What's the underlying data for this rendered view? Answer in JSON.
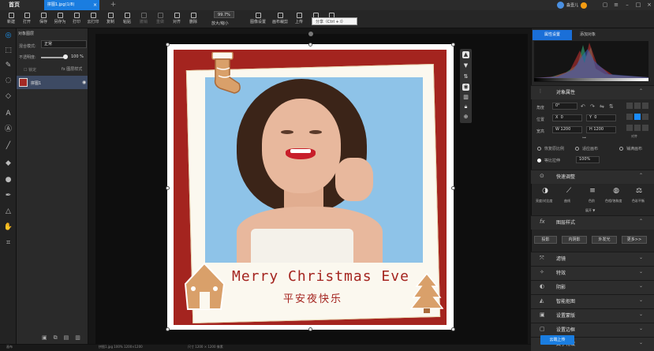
{
  "title_bar": {
    "home_label": "首页",
    "doc_tab_label": "拼图1.jpg(1/8)",
    "doc_tab_close": "×",
    "add_tab": "+",
    "user_name": "淼壹儿"
  },
  "toolbar": {
    "new": "新建",
    "open": "打开",
    "save": "保存",
    "save_as": "另存为",
    "print": "打印",
    "cloud_open": "云打印",
    "copy": "复制",
    "paste": "粘贴",
    "undo": "撤销",
    "redo": "重做",
    "align": "对齐",
    "delete": "删除",
    "zoom_value": "99.7%",
    "zoom_label": "放大/缩小",
    "image_settings": "图像设置",
    "canvas_adjust": "画布裁剪",
    "upload": "上传",
    "share": "分享",
    "tooltip": "分享（Ctrl + I）"
  },
  "layers_panel": {
    "title": "对象图层",
    "blend_label": "混合模式:",
    "blend_value": "正常",
    "opacity_label": "不透明度:",
    "opacity_value": "100 %",
    "opacity_fraction": 1.0,
    "lock_label": "锁定",
    "fx_label": "fx  图层样式",
    "layer_name": "拼图1"
  },
  "canvas": {
    "headline": "Merry Christmas Eve",
    "cn_greeting": "平安夜快乐"
  },
  "status_bar": {
    "left_text": "画布",
    "mid_text": "拼图1.jpg 100% 1200×1200",
    "right_text": "尺寸 1200 × 1200  像素"
  },
  "right_panel": {
    "tab_properties": "属性设置",
    "tab_add_object": "添加对象",
    "object_props_title": "对象属性",
    "angle_label": "角度",
    "angle_value": "0°",
    "position_label": "位置",
    "x_label": "X",
    "x_value": "0",
    "y_label": "Y",
    "y_value": "0",
    "size_label": "宽高",
    "w_label": "W",
    "w_value": "1200",
    "h_label": "H",
    "h_value": "1200",
    "align_label": "对齐",
    "restore_ratio": "恢复原比例",
    "fit_canvas": "适应画布",
    "fill_canvas": "铺满画布",
    "proportional": "等比拉伸",
    "scale_value": "100%",
    "quick_adjust_title": "快速调整",
    "quick_items": [
      "亮度/对比度",
      "曲线",
      "色阶",
      "色相/饱和度",
      "色彩平衡"
    ],
    "expand_label": "展开 ▼",
    "layer_style_title": "图层样式",
    "style_buttons": [
      "投影",
      "内阴影",
      "外发光",
      "更多>>"
    ],
    "sections": [
      "滤镜",
      "特效",
      "阴影",
      "智能抠图",
      "设置蒙版",
      "设置边框",
      "文字特效"
    ],
    "upload_btn": "云端上传"
  },
  "colors": {
    "accent": "#1a7de0",
    "card_red": "#a4241f",
    "photo_bg": "#8ec3e8"
  }
}
